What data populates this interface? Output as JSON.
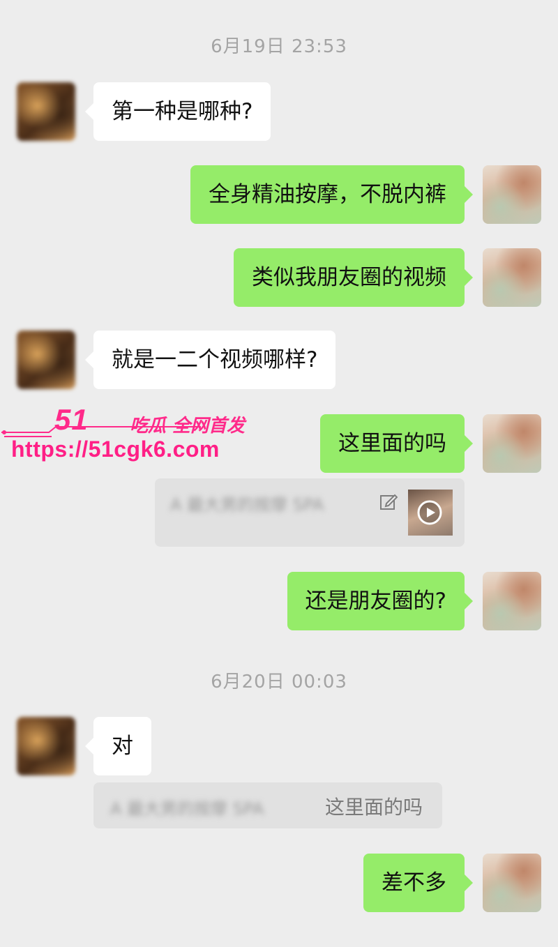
{
  "timestamps": [
    "6月19日 23:53",
    "6月20日 00:03"
  ],
  "messages": [
    {
      "from": "them",
      "text": "第一种是哪种?"
    },
    {
      "from": "me",
      "text": "全身精油按摩，不脱内裤"
    },
    {
      "from": "me",
      "text": "类似我朋友圈的视频"
    },
    {
      "from": "them",
      "text": "就是一二个视频哪样?"
    },
    {
      "from": "me",
      "text": "这里面的吗"
    },
    {
      "from": "me",
      "text": "还是朋友圈的?"
    },
    {
      "from": "them",
      "text": "对"
    },
    {
      "from": "me",
      "text": "差不多"
    }
  ],
  "quote1": {
    "blurred_text": "A 最大男的按摩 SPA",
    "icons": [
      "edit-icon",
      "play-icon"
    ]
  },
  "quote2": {
    "blurred_text": "A 最大男的按摩 SPA",
    "text": "这里面的吗"
  },
  "watermark": {
    "brand": "51",
    "tagline": "吃瓜 全网首发",
    "url": "https://51cgk6.com"
  },
  "colors": {
    "background": "#ededed",
    "my_bubble": "#95ec69",
    "their_bubble": "#ffffff",
    "watermark": "#ff2a8a"
  }
}
